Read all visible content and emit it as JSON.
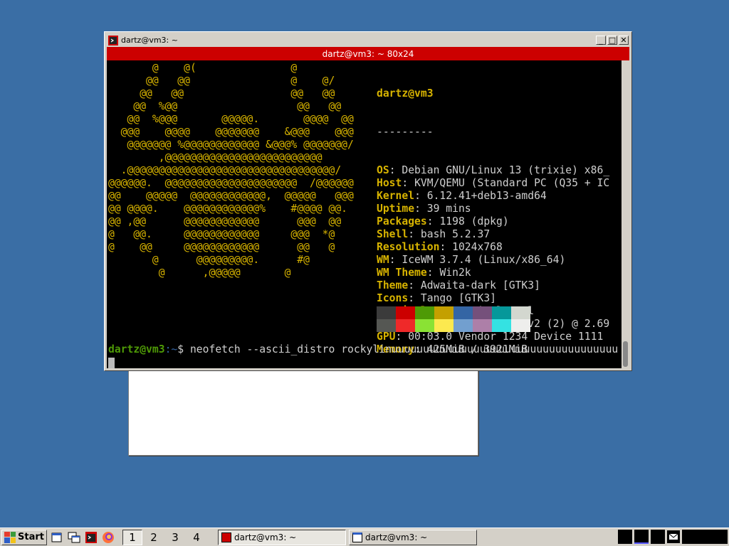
{
  "window": {
    "title": "dartz@vm3: ~",
    "terminal_title": "dartz@vm3: ~ 80x24",
    "min_glyph": "_",
    "max_glyph": "□",
    "close_glyph": "✕"
  },
  "ascii_art": "       @    @(               @          \n      @@   @@                @    @/    \n     @@   @@                 @@   @@    \n    @@  %@@                   @@   @@   \n   @@  %@@@       @@@@@.       @@@@  @@ \n  @@@    @@@@    @@@@@@@    &@@@    @@@ \n   @@@@@@@ %@@@@@@@@@@@@ &@@@% @@@@@@@/ \n        ,@@@@@@@@@@@@@@@@@@@@@@@@@      \n  .@@@@@@@@@@@@@@@@@@@@@@@@@@@@@@@@@/   \n@@@@@@.  @@@@@@@@@@@@@@@@@@@@@  /@@@@@@ \n@@    @@@@@  @@@@@@@@@@@@,  @@@@@   @@@ \n@@ @@@@.    @@@@@@@@@@@@%    #@@@@ @@.  \n@@ ,@@      @@@@@@@@@@@@      @@@  @@   \n@   @@.     @@@@@@@@@@@@     @@@  *@    \n@    @@     @@@@@@@@@@@@      @@   @    \n       @      @@@@@@@@@.      #@        \n        @      ,@@@@@       @           ",
  "neofetch": {
    "user": "dartz@vm3",
    "separator": "---------",
    "rows": [
      {
        "key": "OS",
        "value": "Debian GNU/Linux 13 (trixie) x86_"
      },
      {
        "key": "Host",
        "value": "KVM/QEMU (Standard PC (Q35 + IC"
      },
      {
        "key": "Kernel",
        "value": "6.12.41+deb13-amd64"
      },
      {
        "key": "Uptime",
        "value": "39 mins"
      },
      {
        "key": "Packages",
        "value": "1198 (dpkg)"
      },
      {
        "key": "Shell",
        "value": "bash 5.2.37"
      },
      {
        "key": "Resolution",
        "value": "1024x768"
      },
      {
        "key": "WM",
        "value": "IceWM 3.7.4 (Linux/x86_64)"
      },
      {
        "key": "WM Theme",
        "value": "Win2k"
      },
      {
        "key": "Theme",
        "value": "Adwaita-dark [GTK3]"
      },
      {
        "key": "Icons",
        "value": "Tango [GTK3]"
      },
      {
        "key": "Terminal",
        "value": "x-terminal-emul"
      },
      {
        "key": "CPU",
        "value": "Intel Xeon E5-2697 v2 (2) @ 2.69"
      },
      {
        "key": "GPU",
        "value": "00:03.0 Vendor 1234 Device 1111"
      },
      {
        "key": "Memory",
        "value": "425MiB / 3921MiB"
      }
    ],
    "palette_dark": [
      "#3b3b3b",
      "#cc0000",
      "#4e9a06",
      "#c4a000",
      "#3465a4",
      "#75507b",
      "#06989a",
      "#d3d7cf"
    ],
    "palette_bright": [
      "#555753",
      "#ef2929",
      "#8ae234",
      "#fce94f",
      "#729fcf",
      "#ad7fa8",
      "#34e2e2",
      "#eeeeec"
    ]
  },
  "prompt": {
    "user_host": "dartz@vm3",
    "path": ":~",
    "symbol": "$ ",
    "command": "neofetch --ascii_distro rockylinuuuuuuuuuuuuuuuuuuuuuuuuuuuuuuuuuuuu"
  },
  "taskbar": {
    "start_label": "Start",
    "workspaces": [
      "1",
      "2",
      "3",
      "4"
    ],
    "active_workspace": "1",
    "tasks": [
      {
        "label": "dartz@vm3: ~",
        "icon": "terminal-icon",
        "active": true
      },
      {
        "label": "dartz@vm3: ~",
        "icon": "window-icon",
        "active": false
      }
    ]
  },
  "colors": {
    "desktop": "#3a6ea5",
    "terminal_titlebar": "#cc0000",
    "ascii": "#d7b300",
    "prompt_user": "#4e9a06",
    "prompt_path": "#3465a4"
  }
}
